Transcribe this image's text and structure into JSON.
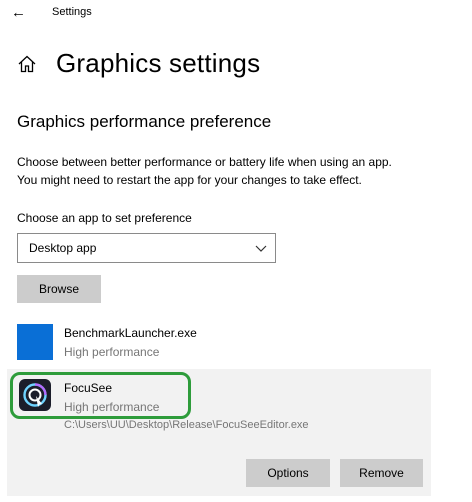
{
  "titlebar": {
    "back_glyph": "←",
    "title": "Settings"
  },
  "header": {
    "icon": "home-icon",
    "title": "Graphics settings"
  },
  "section": {
    "title": "Graphics performance preference",
    "description_line1": "Choose between better performance or battery life when using an app.",
    "description_line2": "You might need to restart the app for your changes to take effect."
  },
  "app_type": {
    "label": "Choose an app to set preference",
    "selected": "Desktop app",
    "browse_label": "Browse"
  },
  "apps": [
    {
      "name": "BenchmarkLauncher.exe",
      "preference": "High performance",
      "tile_color": "#0a6fd6"
    },
    {
      "name": "FocuSee",
      "preference": "High performance",
      "path": "C:\\Users\\UU\\Desktop\\Release\\FocuSeeEditor.exe",
      "options_label": "Options",
      "remove_label": "Remove",
      "highlight_color": "#2e9c3b"
    }
  ]
}
